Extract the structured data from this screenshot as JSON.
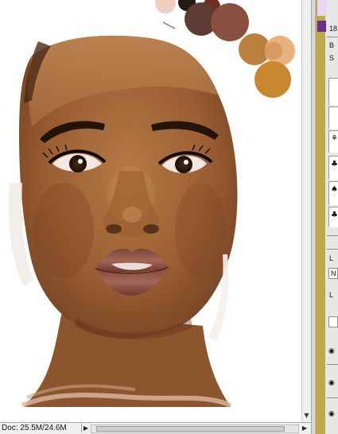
{
  "canvas": {
    "description_icon": "canvas-artwork"
  },
  "statusbar": {
    "doc_size": "Doc: 25.5M/24.6M",
    "arrow_icon": "triangle-right-icon"
  },
  "side_panel": {
    "labels": [
      "18",
      "B",
      "S",
      "L",
      "N",
      "L"
    ],
    "colors": {
      "accent_purple": "#6c2d8c",
      "strip_gold": "#bfa84a"
    }
  }
}
